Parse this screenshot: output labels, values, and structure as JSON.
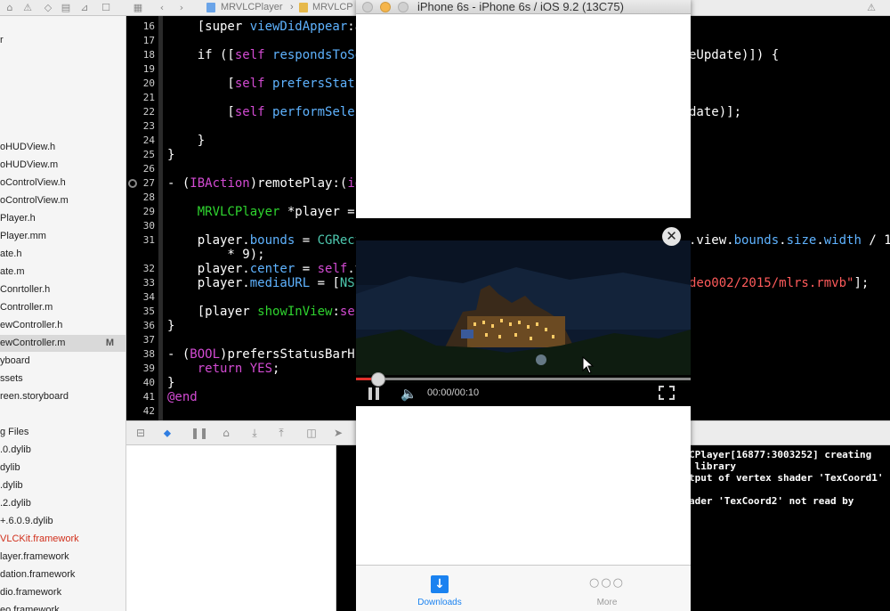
{
  "toolbar": {
    "breadcrumb_project": "MRVLCPlayer",
    "breadcrumb_group": "MRVLCP"
  },
  "navigator": {
    "items": [
      {
        "label": "r",
        "selected": false
      },
      {
        "label": "",
        "selected": false
      },
      {
        "label": "",
        "selected": false
      },
      {
        "label": "",
        "selected": false
      },
      {
        "label": "",
        "selected": false
      },
      {
        "label": "",
        "selected": false
      },
      {
        "label": "oHUDView.h",
        "selected": false
      },
      {
        "label": "oHUDView.m",
        "selected": false
      },
      {
        "label": "oControlView.h",
        "selected": false
      },
      {
        "label": "oControlView.m",
        "selected": false
      },
      {
        "label": "Player.h",
        "selected": false
      },
      {
        "label": "Player.mm",
        "selected": false
      },
      {
        "label": "ate.h",
        "selected": false
      },
      {
        "label": "ate.m",
        "selected": false
      },
      {
        "label": "Conrtoller.h",
        "selected": false
      },
      {
        "label": "Controller.m",
        "selected": false
      },
      {
        "label": "ewController.h",
        "selected": false
      },
      {
        "label": "ewController.m",
        "selected": true,
        "badge": "M"
      },
      {
        "label": "yboard",
        "selected": false
      },
      {
        "label": "ssets",
        "selected": false
      },
      {
        "label": "reen.storyboard",
        "selected": false
      },
      {
        "label": "",
        "selected": false
      },
      {
        "label": "g Files",
        "selected": false
      },
      {
        "label": ".0.dylib",
        "selected": false
      },
      {
        "label": "dylib",
        "selected": false
      },
      {
        "label": ".dylib",
        "selected": false
      },
      {
        "label": ".2.dylib",
        "selected": false
      },
      {
        "label": "+.6.0.9.dylib",
        "selected": false
      },
      {
        "label": "VLCKit.framework",
        "selected": false,
        "missing": true
      },
      {
        "label": "layer.framework",
        "selected": false
      },
      {
        "label": "dation.framework",
        "selected": false
      },
      {
        "label": "dio.framework",
        "selected": false
      },
      {
        "label": "eo.framework",
        "selected": false
      }
    ]
  },
  "editor": {
    "line_numbers": [
      "16",
      "17",
      "18",
      "19",
      "20",
      "21",
      "22",
      "23",
      "24",
      "25",
      "26",
      "27",
      "28",
      "29",
      "30",
      "31",
      "",
      "32",
      "33",
      "34",
      "35",
      "36",
      "37",
      "38",
      "39",
      "40",
      "41",
      "42"
    ],
    "lines": {
      "l16_a": "    [super ",
      "l16_b": "viewDidAppear",
      "l16_c": ":a",
      "l18_a": "    if ([",
      "l18_b": "self",
      "l18_c": " ",
      "l18_d": "respondsToSe",
      "l18_right": "eUpdate)]) {",
      "l20_a": "        [",
      "l20_b": "self",
      "l20_c": " ",
      "l20_d": "prefersStatu",
      "l22_a": "        [",
      "l22_b": "self",
      "l22_c": " ",
      "l22_d": "performSelec",
      "l22_right": "date)];",
      "l23": "    }",
      "l24": "}",
      "l26_a": "- (",
      "l26_b": "IBAction",
      "l26_c": ")remotePlay:(",
      "l26_d": "id",
      "l28_a": "    ",
      "l28_b": "MRVLCPlayer",
      "l28_c": " *player = ",
      "l30_a": "    player.",
      "l30_b": "bounds",
      "l30_c": " = ",
      "l30_d": "CGRect",
      "l30_right_a": ".view.",
      "l30_right_b": "bounds",
      "l30_right_c": ".",
      "l30_right_d": "size",
      "l30_right_e": ".",
      "l30_right_f": "width",
      "l30_right_g": " / 1",
      "l30b": "        * 9);",
      "l31_a": "    player.",
      "l31_b": "center",
      "l31_c": " = ",
      "l31_d": "self",
      "l31_e": ".v",
      "l32_a": "    player.",
      "l32_b": "mediaURL",
      "l32_c": " = [",
      "l32_d": "NS",
      "l32_right": "deo002/2015/mlrs.rmvb\"",
      "l32_right_end": "];",
      "l34_a": "    [player ",
      "l34_b": "showInView",
      "l34_c": ":",
      "l34_d": "se",
      "l35": "}",
      "l37_a": "- (",
      "l37_b": "BOOL",
      "l37_c": ")prefersStatusBarH",
      "l38_a": "    ",
      "l38_b": "return",
      "l38_c": " ",
      "l38_d": "YES",
      "l38_e": ";",
      "l39": "}",
      "l40": "@end"
    }
  },
  "console": {
    "lines": [
      "CPlayer[16877:3003252] creating",
      " library",
      "tput of vertex shader 'TexCoord1'",
      "",
      "ader 'TexCoord2' not read by"
    ]
  },
  "simulator": {
    "title": "iPhone 6s - iPhone 6s / iOS 9.2 (13C75)",
    "player": {
      "close_glyph": "✕",
      "timecode": "00:00/00:10",
      "progress": 0.06
    },
    "tabbar": {
      "tabs": [
        {
          "label": "Downloads",
          "icon": "download-icon",
          "active": true
        },
        {
          "label": "More",
          "icon": "more-icon",
          "active": false
        }
      ],
      "more_glyph": "○○○",
      "download_glyph": "↓"
    }
  },
  "colors": {
    "keyword": "#d34bd3",
    "function": "#5fb3ff",
    "string": "#ff5b5b",
    "class": "#2fd42f",
    "tab_active": "#1a82f0",
    "progress_played": "#e0302b",
    "missing_file": "#d12f1b"
  }
}
